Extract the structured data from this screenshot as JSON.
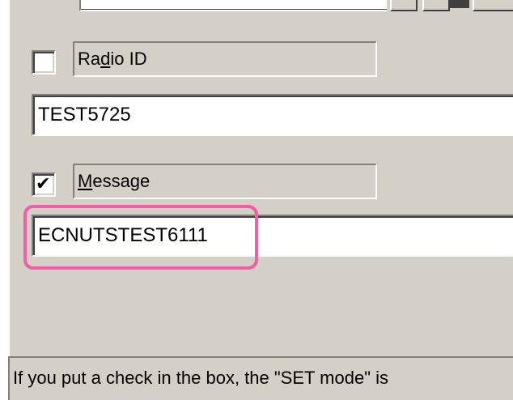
{
  "radio_id": {
    "checked": false,
    "label_prefix": "Ra",
    "label_accel": "d",
    "label_suffix": "io ID",
    "value": "TEST5725"
  },
  "message": {
    "checked": true,
    "check_glyph": "✔",
    "label_accel": "M",
    "label_suffix": "essage",
    "value": "ECNUTSTEST6111"
  },
  "status_bar": {
    "text": "If you put a check in the box, the \"SET mode\" is"
  },
  "colors": {
    "panel_bg": "#d4d0c8",
    "highlight": "#ef5fa7"
  }
}
